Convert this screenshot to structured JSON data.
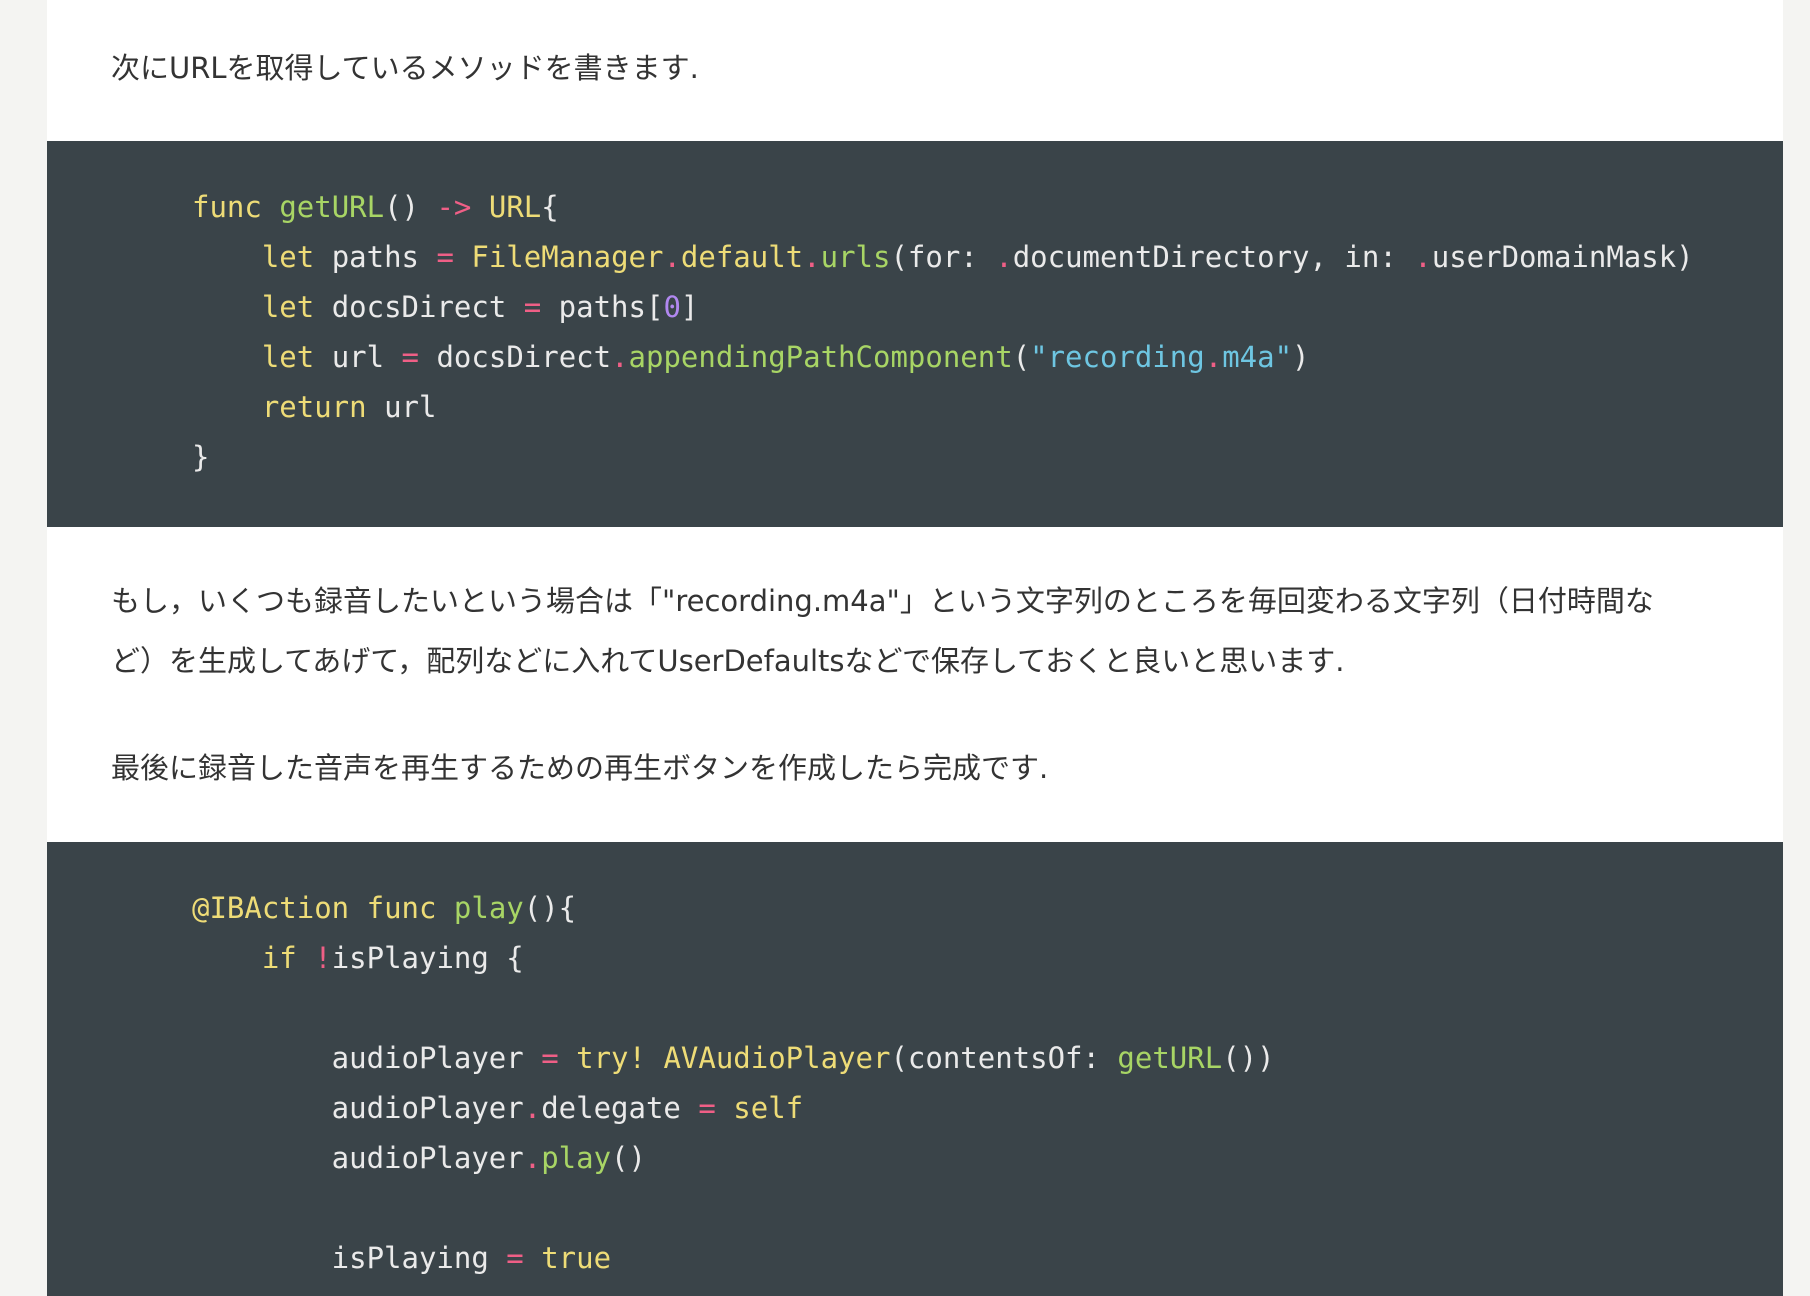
{
  "paragraphs": {
    "p1": "次にURLを取得しているメソッドを書きます.",
    "p2_line1": "もし，いくつも録音したいという場合は「\"recording.m4a\"」という文字列のところを毎回変わる文字列（日付時間な",
    "p2_line2": "ど）を生成してあげて，配列などに入れてUserDefaultsなどで保存しておくと良いと思います.",
    "p3": "最後に録音した音声を再生するための再生ボタンを作成したら完成です."
  },
  "code_blocks": [
    {
      "lines": [
        [
          [
            "kw",
            "func"
          ],
          [
            "tx",
            " "
          ],
          [
            "fn",
            "getURL"
          ],
          [
            "tx",
            "() "
          ],
          [
            "op",
            "->"
          ],
          [
            "tx",
            " "
          ],
          [
            "ty",
            "URL"
          ],
          [
            "tx",
            "{"
          ]
        ],
        [
          [
            "tx",
            "    "
          ],
          [
            "kw",
            "let"
          ],
          [
            "tx",
            " paths "
          ],
          [
            "op",
            "="
          ],
          [
            "tx",
            " "
          ],
          [
            "ty",
            "FileManager"
          ],
          [
            "op",
            "."
          ],
          [
            "ty",
            "default"
          ],
          [
            "op",
            "."
          ],
          [
            "fn",
            "urls"
          ],
          [
            "tx",
            "(for: "
          ],
          [
            "op",
            "."
          ],
          [
            "tx",
            "documentDirectory, in: "
          ],
          [
            "op",
            "."
          ],
          [
            "tx",
            "userDomainMask)"
          ]
        ],
        [
          [
            "tx",
            "    "
          ],
          [
            "kw",
            "let"
          ],
          [
            "tx",
            " docsDirect "
          ],
          [
            "op",
            "="
          ],
          [
            "tx",
            " paths["
          ],
          [
            "nm",
            "0"
          ],
          [
            "tx",
            "]"
          ]
        ],
        [
          [
            "tx",
            "    "
          ],
          [
            "kw",
            "let"
          ],
          [
            "tx",
            " url "
          ],
          [
            "op",
            "="
          ],
          [
            "tx",
            " docsDirect"
          ],
          [
            "op",
            "."
          ],
          [
            "fn",
            "appendingPathComponent"
          ],
          [
            "tx",
            "("
          ],
          [
            "st",
            "\"recording"
          ],
          [
            "op",
            "."
          ],
          [
            "st",
            "m4a\""
          ],
          [
            "tx",
            ")"
          ]
        ],
        [
          [
            "tx",
            "    "
          ],
          [
            "kw",
            "return"
          ],
          [
            "tx",
            " url"
          ]
        ],
        [
          [
            "tx",
            "}"
          ]
        ]
      ]
    },
    {
      "lines": [
        [
          [
            "kw",
            "@IBAction"
          ],
          [
            "tx",
            " "
          ],
          [
            "kw",
            "func"
          ],
          [
            "tx",
            " "
          ],
          [
            "fn",
            "play"
          ],
          [
            "tx",
            "(){"
          ]
        ],
        [
          [
            "tx",
            "    "
          ],
          [
            "kw",
            "if"
          ],
          [
            "tx",
            " "
          ],
          [
            "op",
            "!"
          ],
          [
            "tx",
            "isPlaying {"
          ]
        ],
        [
          [
            "tx",
            ""
          ]
        ],
        [
          [
            "tx",
            "        audioPlayer "
          ],
          [
            "op",
            "="
          ],
          [
            "tx",
            " "
          ],
          [
            "kw",
            "try!"
          ],
          [
            "tx",
            " "
          ],
          [
            "ty",
            "AVAudioPlayer"
          ],
          [
            "tx",
            "(contentsOf: "
          ],
          [
            "fn",
            "getURL"
          ],
          [
            "tx",
            "())"
          ]
        ],
        [
          [
            "tx",
            "        audioPlayer"
          ],
          [
            "op",
            "."
          ],
          [
            "tx",
            "delegate "
          ],
          [
            "op",
            "="
          ],
          [
            "tx",
            " "
          ],
          [
            "kw",
            "self"
          ]
        ],
        [
          [
            "tx",
            "        audioPlayer"
          ],
          [
            "op",
            "."
          ],
          [
            "fn",
            "play"
          ],
          [
            "tx",
            "()"
          ]
        ],
        [
          [
            "tx",
            ""
          ]
        ],
        [
          [
            "tx",
            "        isPlaying "
          ],
          [
            "op",
            "="
          ],
          [
            "tx",
            " "
          ],
          [
            "kw",
            "true"
          ]
        ]
      ]
    }
  ]
}
